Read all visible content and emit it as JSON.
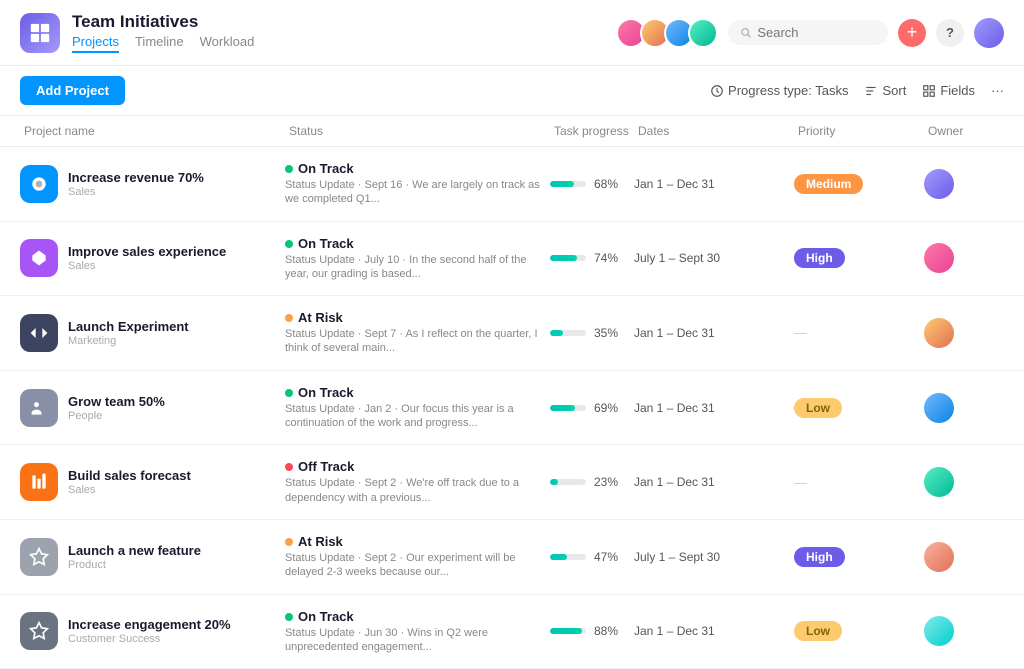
{
  "app": {
    "name": "Team Initiatives",
    "icon": "grid-icon"
  },
  "nav": {
    "tabs": [
      {
        "label": "Projects",
        "active": true
      },
      {
        "label": "Timeline",
        "active": false
      },
      {
        "label": "Workload",
        "active": false
      }
    ]
  },
  "toolbar": {
    "add_project_label": "Add Project",
    "progress_type_label": "Progress type: Tasks",
    "sort_label": "Sort",
    "fields_label": "Fields"
  },
  "table": {
    "headers": [
      "Project name",
      "Status",
      "Task progress",
      "Dates",
      "Priority",
      "Owner"
    ],
    "rows": [
      {
        "icon_color": "blue",
        "name": "Increase revenue 70%",
        "category": "Sales",
        "status_type": "on_track",
        "status_label": "On Track",
        "status_update": "Status Update · Sept 16 · We are largely on track as we completed Q1...",
        "progress": 68,
        "dates": "Jan 1 – Dec 31",
        "priority": "Medium",
        "priority_type": "medium",
        "owner_color": "av1"
      },
      {
        "icon_color": "purple",
        "name": "Improve sales experience",
        "category": "Sales",
        "status_type": "on_track",
        "status_label": "On Track",
        "status_update": "Status Update · July 10 · In the second half of the year, our grading is based...",
        "progress": 74,
        "dates": "July 1 – Sept 30",
        "priority": "High",
        "priority_type": "high",
        "owner_color": "av2"
      },
      {
        "icon_color": "dark",
        "name": "Launch Experiment",
        "category": "Marketing",
        "status_type": "at_risk",
        "status_label": "At Risk",
        "status_update": "Status Update · Sept 7 · As I reflect on the quarter, I think of several main...",
        "progress": 35,
        "dates": "Jan 1 – Dec 31",
        "priority": "—",
        "priority_type": "none",
        "owner_color": "av3"
      },
      {
        "icon_color": "gray",
        "name": "Grow team 50%",
        "category": "People",
        "status_type": "on_track",
        "status_label": "On Track",
        "status_update": "Status Update · Jan 2 · Our focus this year is a continuation of the work and progress...",
        "progress": 69,
        "dates": "Jan 1 – Dec 31",
        "priority": "Low",
        "priority_type": "low",
        "owner_color": "av4"
      },
      {
        "icon_color": "orange",
        "name": "Build sales forecast",
        "category": "Sales",
        "status_type": "off_track",
        "status_label": "Off Track",
        "status_update": "Status Update · Sept 2 · We're off track due to a dependency with a previous...",
        "progress": 23,
        "dates": "Jan 1 – Dec 31",
        "priority": "—",
        "priority_type": "none",
        "owner_color": "av5"
      },
      {
        "icon_color": "gray2",
        "name": "Launch a new feature",
        "category": "Product",
        "status_type": "at_risk",
        "status_label": "At Risk",
        "status_update": "Status Update · Sept 2 · Our experiment will be delayed 2-3 weeks because our...",
        "progress": 47,
        "dates": "July 1 – Sept 30",
        "priority": "High",
        "priority_type": "high",
        "owner_color": "av6"
      },
      {
        "icon_color": "gray3",
        "name": "Increase engagement 20%",
        "category": "Customer Success",
        "status_type": "on_track",
        "status_label": "On Track",
        "status_update": "Status Update · Jun 30 · Wins in Q2 were unprecedented engagement...",
        "progress": 88,
        "dates": "Jan 1 – Dec 31",
        "priority": "Low",
        "priority_type": "low",
        "owner_color": "av7"
      }
    ]
  }
}
